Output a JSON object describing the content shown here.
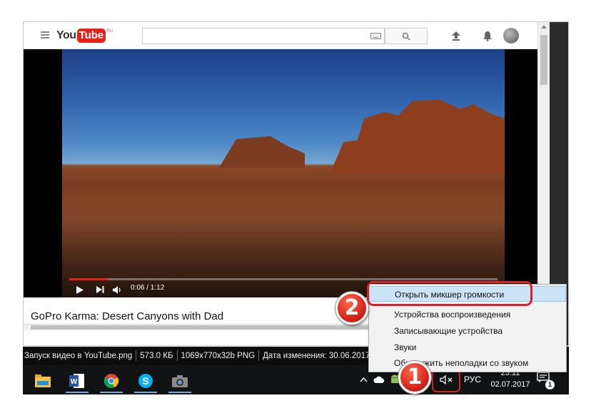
{
  "browser": {
    "logo": {
      "you": "You",
      "tube": "Tube",
      "region": "RU"
    },
    "search": {
      "placeholder": ""
    }
  },
  "player": {
    "time_current": "0:06",
    "time_total": "1:12",
    "time_display": "0:06 / 1:12",
    "progress_fraction": 0.09
  },
  "video": {
    "title": "GoPro Karma: Desert Canyons with Dad"
  },
  "status_bar": {
    "filename": "Запуск видео в YouTube.png",
    "size": "573.0 КБ",
    "dimensions": "1069x770x32b PNG",
    "modified": "Дата изменения: 30.06.2017 1"
  },
  "context_menu": {
    "items": [
      {
        "label": "Открыть микшер громкости",
        "highlighted": true
      },
      {
        "label": "Устройства воспроизведения"
      },
      {
        "label": "Записывающие устройства"
      },
      {
        "label": "Звуки"
      },
      {
        "label": "Обнаружить неполадки со звуком"
      }
    ]
  },
  "taskbar": {
    "apps": [
      {
        "icon": "file-explorer-icon"
      },
      {
        "icon": "word-icon"
      },
      {
        "icon": "chrome-icon"
      },
      {
        "icon": "skype-icon"
      },
      {
        "icon": "camera-icon"
      }
    ],
    "language": "РУС",
    "time": "23:11",
    "date": "02.07.2017",
    "notification_count": "1"
  },
  "annotations": {
    "step1": "1",
    "step2": "2"
  },
  "colors": {
    "youtube_red": "#e62117",
    "highlight_red": "#d3232b",
    "taskbar": "#101214",
    "menu_hover": "#cce4f7"
  }
}
